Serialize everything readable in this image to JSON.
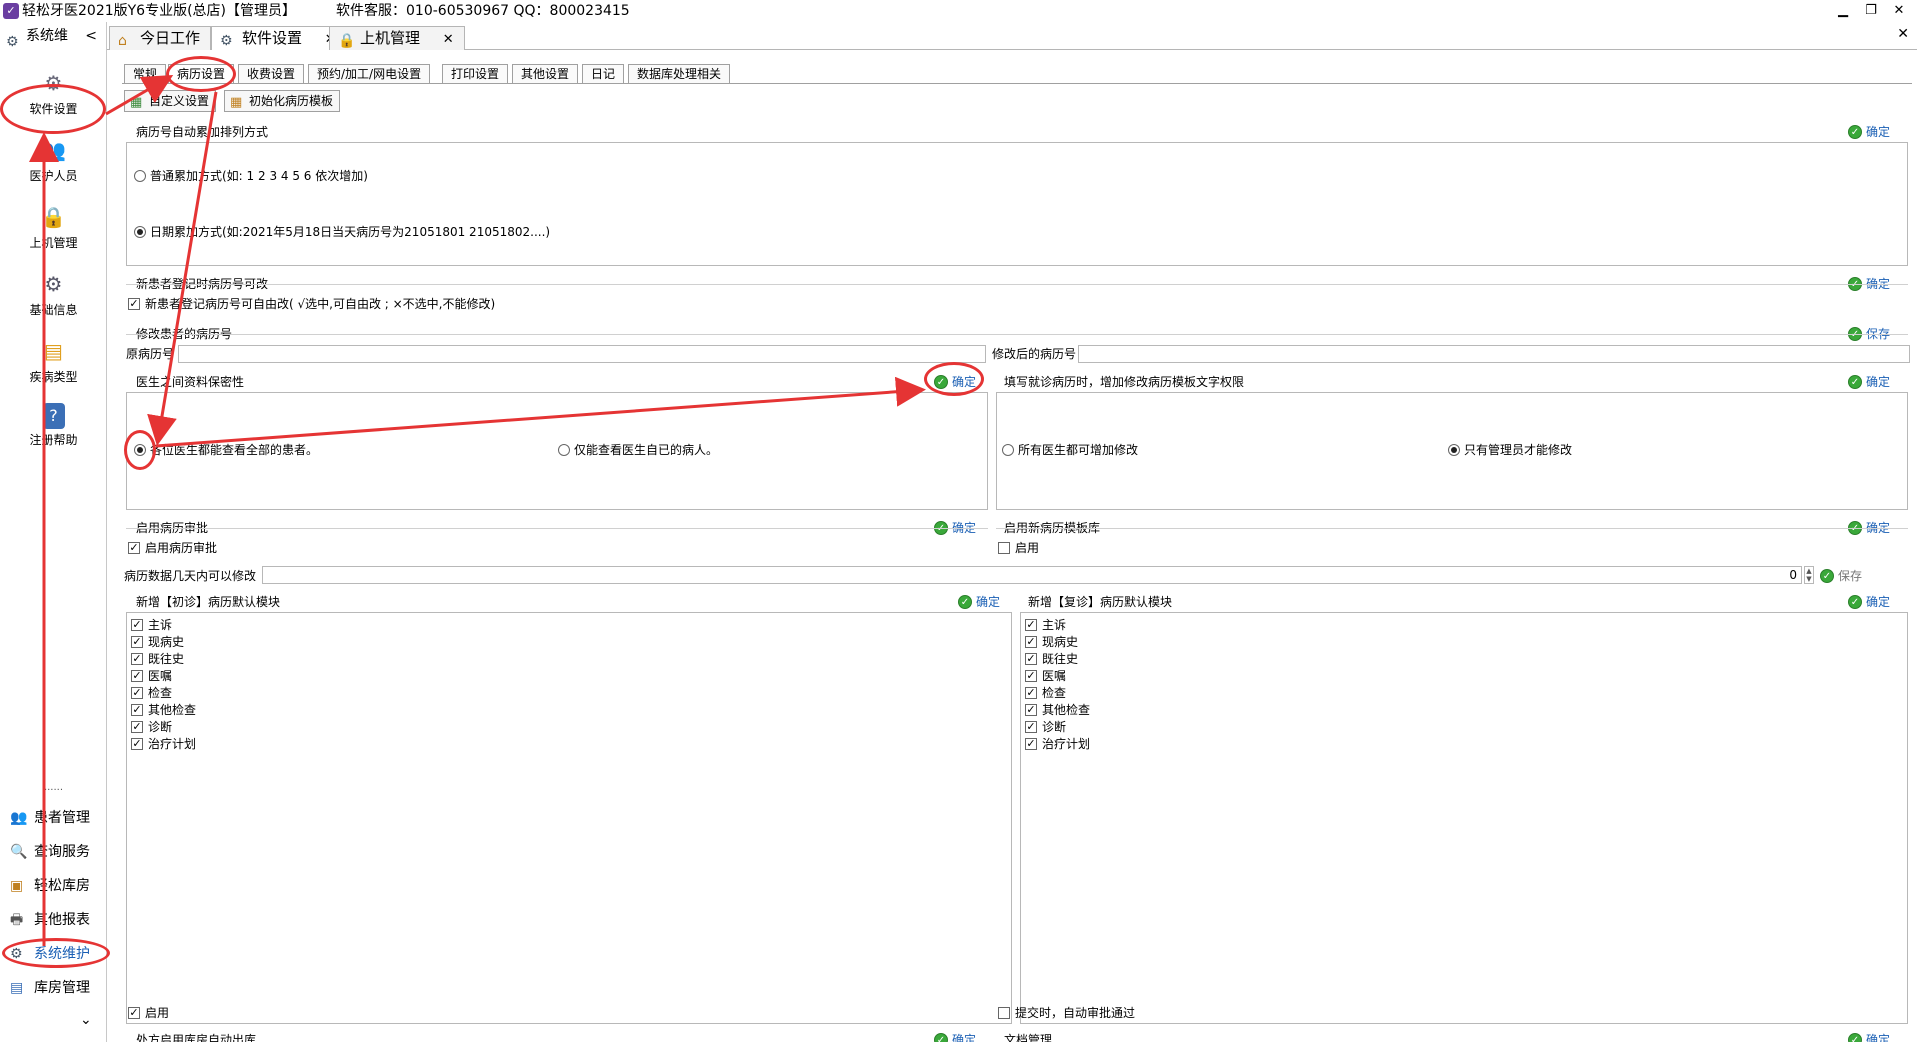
{
  "window": {
    "title": "轻松牙医2021版Y6专业版(总店)【管理员】",
    "service": "软件客服：010-60530967  QQ：800023415",
    "minimize": "▁",
    "restore": "❐",
    "close": "✕"
  },
  "left_panel": {
    "header": "系统维",
    "collapse": "<",
    "nav": [
      "软件设置",
      "医护人员",
      "上机管理",
      "基础信息",
      "疾病类型",
      "注册帮助"
    ],
    "dots": "......",
    "bottom_nav": [
      "患者管理",
      "查询服务",
      "轻松库房",
      "其他报表",
      "系统维护",
      "库房管理"
    ],
    "expand": "⌄"
  },
  "main_tabs": [
    {
      "label": "今日工作",
      "closable": false
    },
    {
      "label": "软件设置",
      "closable": true
    },
    {
      "label": "上机管理",
      "closable": true
    }
  ],
  "tab_close": "✕",
  "close_all": "✕",
  "sub_tabs": [
    "常规",
    "病历设置",
    "收费设置",
    "预约/加工/网电设置",
    "打印设置",
    "其他设置",
    "日记",
    "数据库处理相关"
  ],
  "toolbar": {
    "custom": "自定义设置",
    "init_template": "初始化病历模板"
  },
  "sections": {
    "numbering": {
      "title": "病历号自动累加排列方式",
      "confirm": "确定",
      "opt_normal": "普通累加方式(如: 1  2  3  4  5  6 依次增加)",
      "opt_date": "日期累加方式(如:2021年5月18日当天病历号为21051801 21051802....)",
      "selected": "date"
    },
    "editable": {
      "title": "新患者登记时病历号可改",
      "confirm": "确定",
      "checkbox": "新患者登记病历号可自由改( √选中,可自由改 ;  ×不选中,不能修改)",
      "checked": true
    },
    "modify": {
      "title": "修改患者的病历号",
      "save": "保存",
      "orig_label": "原病历号",
      "new_label": "修改后的病历号",
      "orig_value": "",
      "new_value": ""
    },
    "privacy": {
      "title": "医生之间资料保密性",
      "confirm": "确定",
      "opt_all": "各位医生都能查看全部的患者。",
      "opt_own": "仅能查看医生自已的病人。",
      "selected": "all"
    },
    "template_perm": {
      "title": "填写就诊病历时，增加修改病历模板文字权限",
      "confirm": "确定",
      "opt_all": "所有医生都可增加修改",
      "opt_admin": "只有管理员才能修改",
      "selected": "admin"
    },
    "approval": {
      "title": "启用病历审批",
      "confirm": "确定",
      "checkbox": "启用病历审批",
      "checked": true
    },
    "new_lib": {
      "title": "启用新病历模板库",
      "confirm": "确定",
      "checkbox": "启用",
      "checked": false
    },
    "days": {
      "label": "病历数据几天内可以修改",
      "value": "0",
      "save": "保存"
    },
    "first_visit": {
      "title": "新增【初诊】病历默认模块",
      "confirm": "确定",
      "items": [
        "主诉",
        "现病史",
        "既往史",
        "医嘱",
        "检查",
        "其他检查",
        "诊断",
        "治疗计划"
      ]
    },
    "return_visit": {
      "title": "新增【复诊】病历默认模块",
      "confirm": "确定",
      "items": [
        "主诉",
        "现病史",
        "既往史",
        "医嘱",
        "检查",
        "其他检查",
        "诊断",
        "治疗计划"
      ]
    },
    "pharmacy": {
      "title": "处方启用库房自动出库",
      "confirm": "确定",
      "checkbox": "启用",
      "checked": true
    },
    "docs": {
      "title": "文档管理",
      "confirm": "确定",
      "checkbox": "提交时，自动审批通过",
      "checked": false
    }
  },
  "colors": {
    "annotation": "#e53434",
    "confirm_text": "#1a5fb4",
    "ok_icon": "#3aa83a"
  }
}
